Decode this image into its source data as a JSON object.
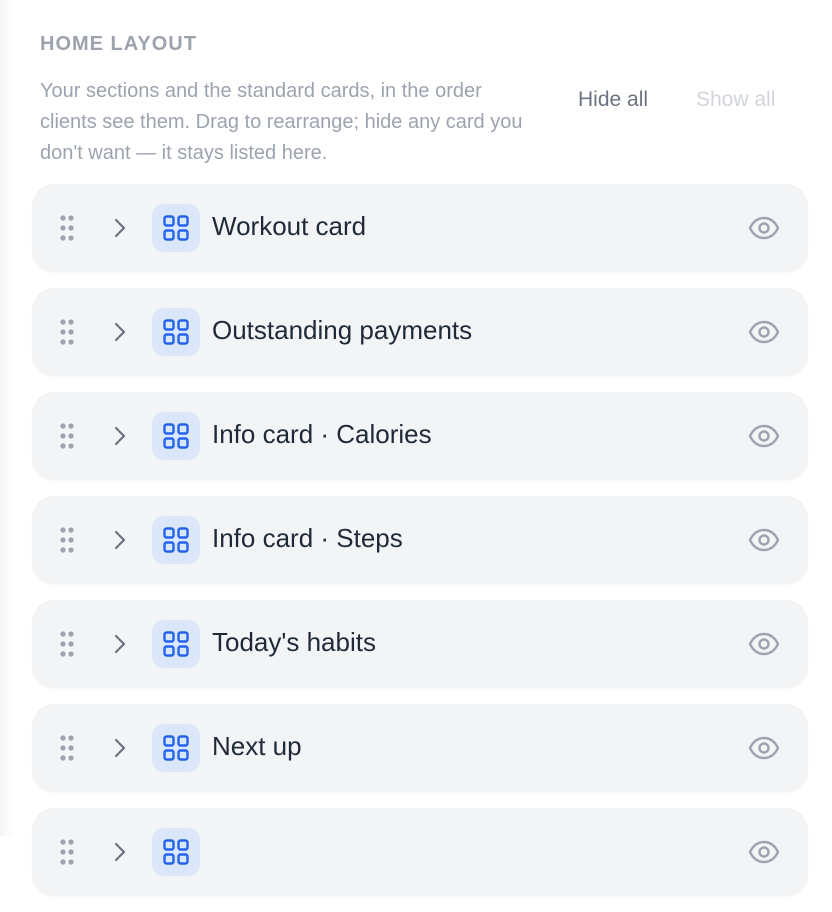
{
  "panel": {
    "title": "HOME LAYOUT",
    "description": "Your sections and the standard cards, in the order clients see them. Drag to rearrange; hide any card you don't want — it stays listed here.",
    "hide_all_label": "Hide all",
    "show_all_label": "Show all"
  },
  "colors": {
    "accent": "#2563eb",
    "icon_bg": "#dbe6fb",
    "card_bg": "#f3f4f6",
    "muted_text": "#9ca3af"
  },
  "cards": [
    {
      "label": "Workout card",
      "icon": "grid-icon",
      "visible": true
    },
    {
      "label": "Outstanding payments",
      "icon": "grid-icon",
      "visible": true
    },
    {
      "label": "Info card · Calories",
      "icon": "grid-icon",
      "visible": true
    },
    {
      "label": "Info card · Steps",
      "icon": "grid-icon",
      "visible": true
    },
    {
      "label": "Today's habits",
      "icon": "grid-icon",
      "visible": true
    },
    {
      "label": "Next up",
      "icon": "grid-icon",
      "visible": true
    },
    {
      "label": "",
      "icon": "grid-icon",
      "visible": true
    }
  ]
}
